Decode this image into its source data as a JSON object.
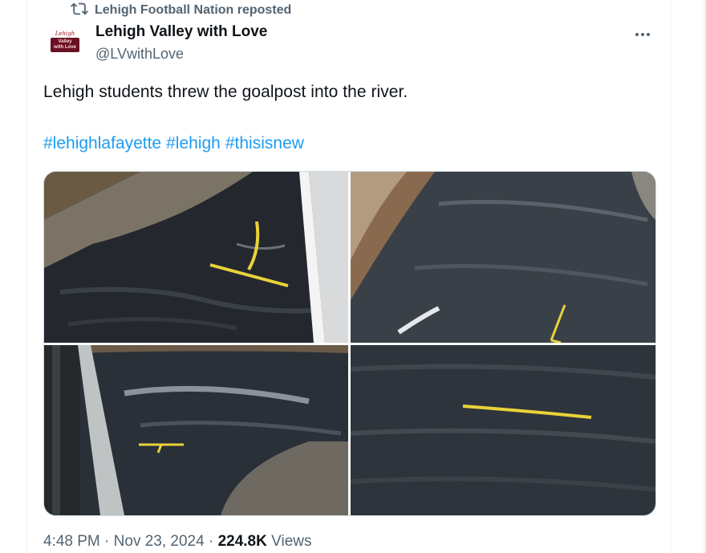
{
  "repost": {
    "label": "Lehigh Football Nation reposted",
    "icon": "repost-icon"
  },
  "author": {
    "avatar_line1": "Lehigh",
    "avatar_line2": "Valley",
    "avatar_line3": "with Love",
    "name": "Lehigh Valley with Love",
    "handle": "@LVwithLove"
  },
  "more_label": "•••",
  "tweet": {
    "text": "Lehigh students threw the goalpost into the river.",
    "hashtags": [
      "#lehighlafayette",
      "#lehigh",
      "#thisisnew"
    ]
  },
  "media": {
    "count": 4,
    "colors": {
      "river": "#23272d",
      "goalpost": "#e8d23a",
      "bank": "#8a6a4f",
      "bridge": "#bfc3c3"
    }
  },
  "meta": {
    "time": "4:48 PM",
    "sep1": " · ",
    "date": "Nov 23, 2024",
    "sep2": " · ",
    "views_count": "224.8K",
    "views_label": " Views"
  }
}
